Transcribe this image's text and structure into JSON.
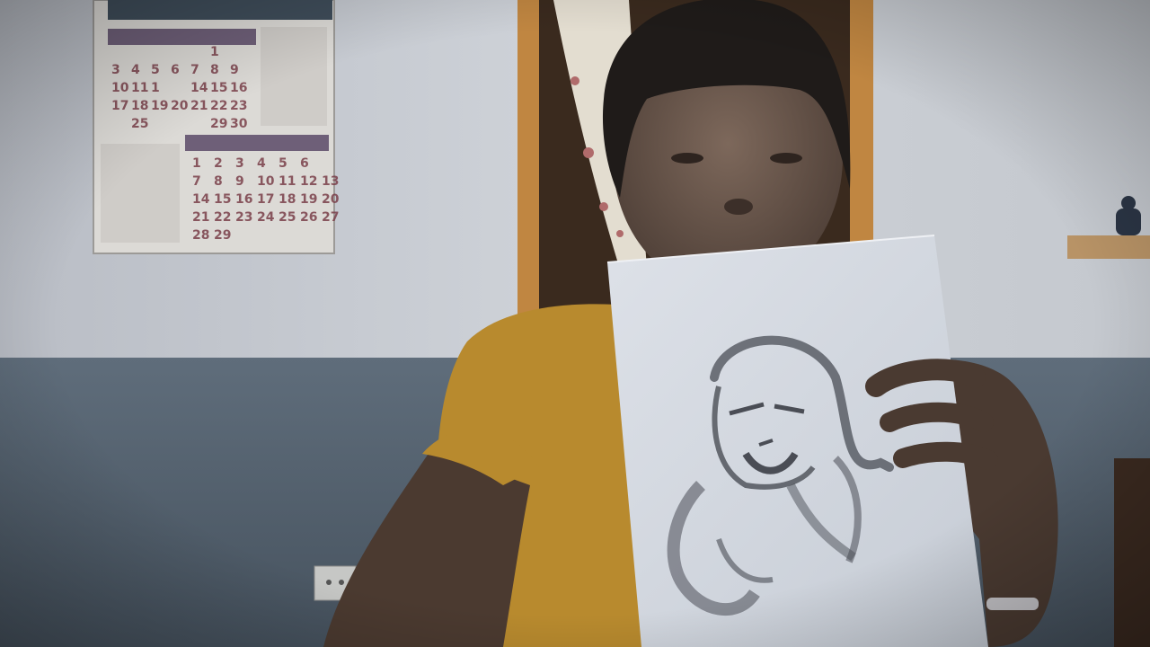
{
  "colors": {
    "wall_upper": "#c9ccd2",
    "wall_lower": "#5c6a78",
    "door_frame": "#b07a3c",
    "curtain": "#e4ded2",
    "shirt": "#b88a2e",
    "skin": "#6e5a4e",
    "hair": "#1f1b19",
    "paper": "#d7dce4",
    "sketch": "#4a4d55",
    "calendar_bg": "#d8d6d2",
    "calendar_header": "#6e5f78",
    "calendar_digit": "#7a3f4a"
  },
  "calendar": {
    "upper_rows": [
      [
        "",
        "",
        "",
        "",
        "",
        "1"
      ],
      [
        "3",
        "4",
        "5",
        "6",
        "7",
        "8",
        "9"
      ],
      [
        "10",
        "11",
        "1",
        "",
        "14",
        "15",
        "16"
      ],
      [
        "17",
        "18",
        "19",
        "20",
        "21",
        "22",
        "23"
      ],
      [
        "",
        "25",
        "",
        "",
        "",
        "29",
        "30"
      ]
    ],
    "lower_rows": [
      [
        "",
        "",
        "1",
        "2",
        "3",
        "4",
        "5",
        "6"
      ],
      [
        "",
        "",
        "7",
        "8",
        "9",
        "10",
        "11",
        "12",
        "13"
      ],
      [
        "",
        "",
        "14",
        "15",
        "16",
        "17",
        "18",
        "19",
        "20"
      ],
      [
        "",
        "",
        "21",
        "22",
        "23",
        "24",
        "25",
        "26",
        "27"
      ],
      [
        "",
        "",
        "28",
        "29"
      ]
    ]
  },
  "icons": {
    "wall_outlet": "outlet-icon",
    "shelf_figurine": "figurine-icon"
  }
}
